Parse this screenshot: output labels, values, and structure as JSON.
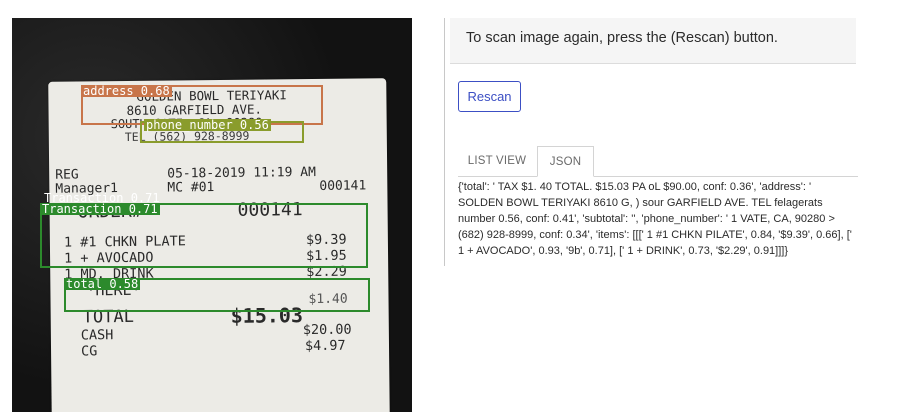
{
  "hint": {
    "text": "To scan image again, press the (Rescan) button."
  },
  "actions": {
    "rescan_label": "Rescan"
  },
  "tabs": [
    {
      "label": "LIST VIEW",
      "active": false
    },
    {
      "label": "JSON",
      "active": true
    }
  ],
  "json_output": "{'total': ' TAX $1. 40 TOTAL. $15.03 PA oL $90.00, conf: 0.36', 'address': ' SOLDEN BOWL TERIYAKI 8610 G, ) sour GARFIELD AVE. TEL felagerats number 0.56, conf: 0.41', 'subtotal': '', 'phone_number': ' 1 VATE, CA, 90280 > (682) 928-8999, conf: 0.34', 'items': [[[' 1 #1 CHKN PILATE', 0.84, '$9.39', 0.66], [' 1 + AVOCADO', 0.93, '9b', 0.71], [' 1 + DRINK', 0.73, '$2.29', 0.91]]]}",
  "receipt": {
    "lines": {
      "store": "GOLDEN BOWL TERIYAKI",
      "street": "8610 GARFIELD AVE.",
      "city": "SOUTH GATE, CA, 90280",
      "phone": "TEL (562) 928-8999",
      "reg": "REG",
      "date": "05-18-2019 11:19 AM",
      "manager": "Manager1",
      "mc": "MC #01",
      "ticket": "000141",
      "order": "ORDER#",
      "order_no": "000141",
      "item1": "1 #1 CHKN PLATE",
      "price1": "$9.39",
      "item2": "1 + AVOCADO",
      "price2": "$1.95",
      "item3": "1 MD. DRINK",
      "price3": "$2.29",
      "here": "*HERE*",
      "tax": "$1.40",
      "total_label": "TOTAL",
      "total": "$15.03",
      "cash": "CASH",
      "cash_amt": "$20.00",
      "cg": "CG",
      "cg_amt": "$4.97"
    },
    "detections": {
      "address": "address 0.68",
      "phone": "phone_number 0.56",
      "transaction_shadow": "Transaction 0.71",
      "transaction": "Transaction 0.71",
      "total": "total 0.58"
    }
  },
  "colors": {
    "address_box": "#c8754a",
    "phone_box": "#8a9c2c",
    "transaction_box": "#2c8a2c",
    "total_box": "#2c8a2c",
    "accent": "#3c4fc4"
  }
}
